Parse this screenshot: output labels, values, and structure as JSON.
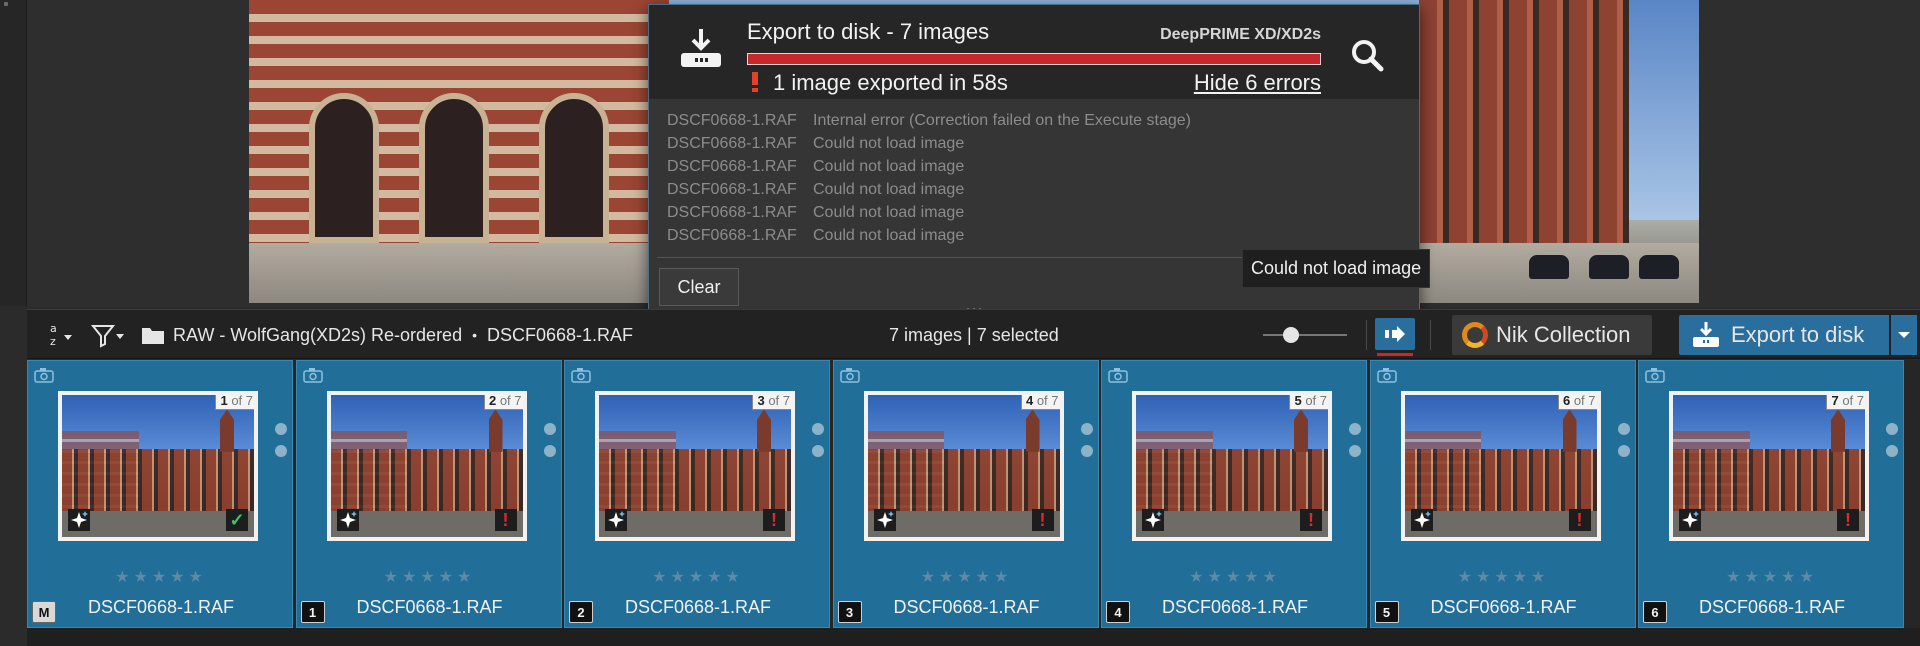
{
  "popup": {
    "title": "Export to disk - 7 images",
    "engine": "DeepPRIME XD/XD2s",
    "progress_percent": 100,
    "progress_color": "#c8282b",
    "status": "1 image exported in 58s",
    "hide_errors": "Hide 6 errors",
    "errors": [
      {
        "file": "DSCF0668-1.RAF",
        "message": "Internal error (Correction failed on the Execute stage)"
      },
      {
        "file": "DSCF0668-1.RAF",
        "message": "Could not load image"
      },
      {
        "file": "DSCF0668-1.RAF",
        "message": "Could not load image"
      },
      {
        "file": "DSCF0668-1.RAF",
        "message": "Could not load image"
      },
      {
        "file": "DSCF0668-1.RAF",
        "message": "Could not load image"
      },
      {
        "file": "DSCF0668-1.RAF",
        "message": "Could not load image"
      }
    ],
    "clear": "Clear",
    "tooltip": "Could not load image"
  },
  "toolbar": {
    "sort_label": "a",
    "sort_label2": "z",
    "folder": "RAW - WolfGang(XD2s) Re-ordered",
    "separator": "•",
    "file": "DSCF0668-1.RAF",
    "count": "7 images | 7 selected",
    "zoom_level": 0.3,
    "nik": "Nik Collection",
    "export": "Export to disk",
    "accent": "#2a6e9e"
  },
  "filmstrip": {
    "of_text": "of 7",
    "stars": "★★★★★",
    "items": [
      {
        "index": "1",
        "file": "DSCF0668-1.RAF",
        "tag": "M",
        "status": "ok"
      },
      {
        "index": "2",
        "file": "DSCF0668-1.RAF",
        "tag": "1",
        "status": "error"
      },
      {
        "index": "3",
        "file": "DSCF0668-1.RAF",
        "tag": "2",
        "status": "error"
      },
      {
        "index": "4",
        "file": "DSCF0668-1.RAF",
        "tag": "3",
        "status": "error"
      },
      {
        "index": "5",
        "file": "DSCF0668-1.RAF",
        "tag": "4",
        "status": "error"
      },
      {
        "index": "6",
        "file": "DSCF0668-1.RAF",
        "tag": "5",
        "status": "error"
      },
      {
        "index": "7",
        "file": "DSCF0668-1.RAF",
        "tag": "6",
        "status": "error"
      }
    ]
  }
}
